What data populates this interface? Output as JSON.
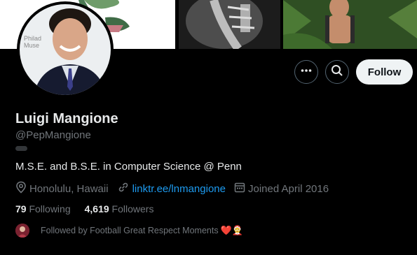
{
  "profile": {
    "display_name": "Luigi Mangione",
    "handle": "@PepMangione",
    "bio": "M.S.E. and B.S.E. in Computer Science @ Penn",
    "location": "Honolulu, Hawaii",
    "website": "linktr.ee/lnmangione",
    "joined": "Joined April 2016",
    "avatar_backdrop_text": "Philad\nMuse"
  },
  "stats": {
    "following_count": "79",
    "following_label": "Following",
    "followers_count": "4,619",
    "followers_label": "Followers"
  },
  "followed_by": {
    "text": "Followed by Football Great Respect Moments",
    "emoji": "❤️🤶"
  },
  "actions": {
    "follow_label": "Follow"
  },
  "icons": {
    "more": "more-icon",
    "search": "search-icon",
    "location": "location-pin-icon",
    "link": "link-icon",
    "calendar": "calendar-icon"
  },
  "colors": {
    "background": "#000000",
    "primary_text": "#e7e9ea",
    "secondary_text": "#71767b",
    "link": "#1d9bf0",
    "follow_button_bg": "#eff3f4",
    "heart": "#f91880"
  }
}
